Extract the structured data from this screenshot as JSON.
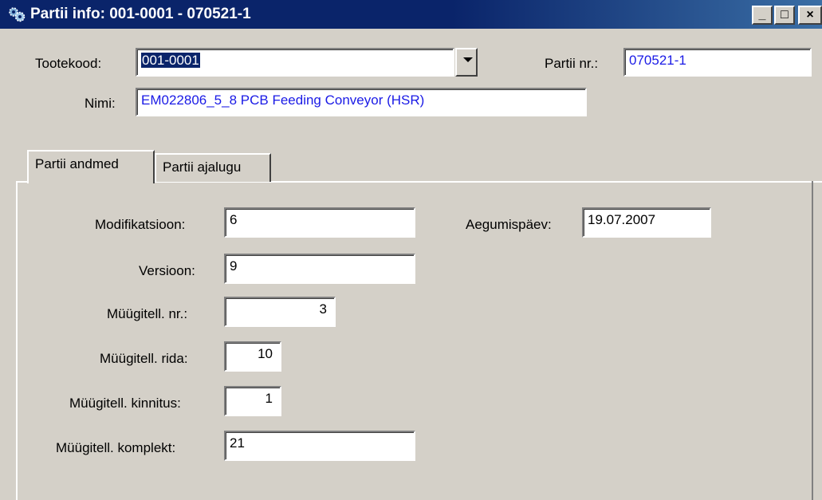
{
  "window": {
    "title": "Partii info: 001-0001 - 070521-1",
    "icon": "app-gears-icon",
    "buttons": {
      "minimize": "_",
      "maximize": "□",
      "close": "×"
    }
  },
  "header": {
    "tootekood_label": "Tootekood:",
    "tootekood_value": "001-0001",
    "partii_nr_label": "Partii nr.:",
    "partii_nr_value": "070521-1",
    "nimi_label": "Nimi:",
    "nimi_value": "EM022806_5_8 PCB Feeding Conveyor (HSR)"
  },
  "tabs": [
    {
      "label": "Partii andmed",
      "active": true
    },
    {
      "label": "Partii ajalugu",
      "active": false
    }
  ],
  "fields": {
    "modifikatsioon_label": "Modifikatsioon:",
    "modifikatsioon_value": "6",
    "versioon_label": "Versioon:",
    "versioon_value": "9",
    "myygitell_nr_label": "Müügitell. nr.:",
    "myygitell_nr_value": "3",
    "myygitell_rida_label": "Müügitell. rida:",
    "myygitell_rida_value": "10",
    "myygitell_kinnitus_label": "Müügitell. kinnitus:",
    "myygitell_kinnitus_value": "1",
    "myygitell_komplekt_label": "Müügitell. komplekt:",
    "myygitell_komplekt_value": "21",
    "aegumispaev_label": "Aegumispäev:",
    "aegumispaev_value": "19.07.2007"
  },
  "colors": {
    "titlebar": "#0a246a",
    "face": "#d4d0c8",
    "value_text": "#1a1ae6"
  }
}
